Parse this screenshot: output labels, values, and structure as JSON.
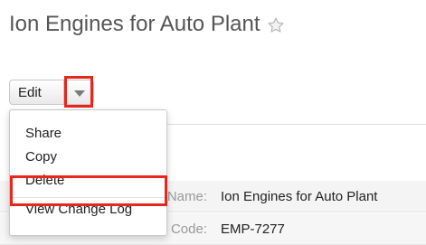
{
  "record": {
    "title": "Ion Engines for Auto Plant",
    "favorite_icon": "star-outline-icon"
  },
  "actions": {
    "edit_label": "Edit",
    "dropdown_icon": "caret-down-icon"
  },
  "menu": {
    "items": [
      {
        "label": "Share"
      },
      {
        "label": "Copy"
      },
      {
        "label": "Delete"
      },
      {
        "label": "View Change Log"
      }
    ]
  },
  "details": {
    "rows": [
      {
        "label": "Name:",
        "value": "Ion Engines for Auto Plant"
      },
      {
        "label": "Code:",
        "value": "EMP-7277"
      }
    ]
  },
  "highlight_color": "#e8271c"
}
